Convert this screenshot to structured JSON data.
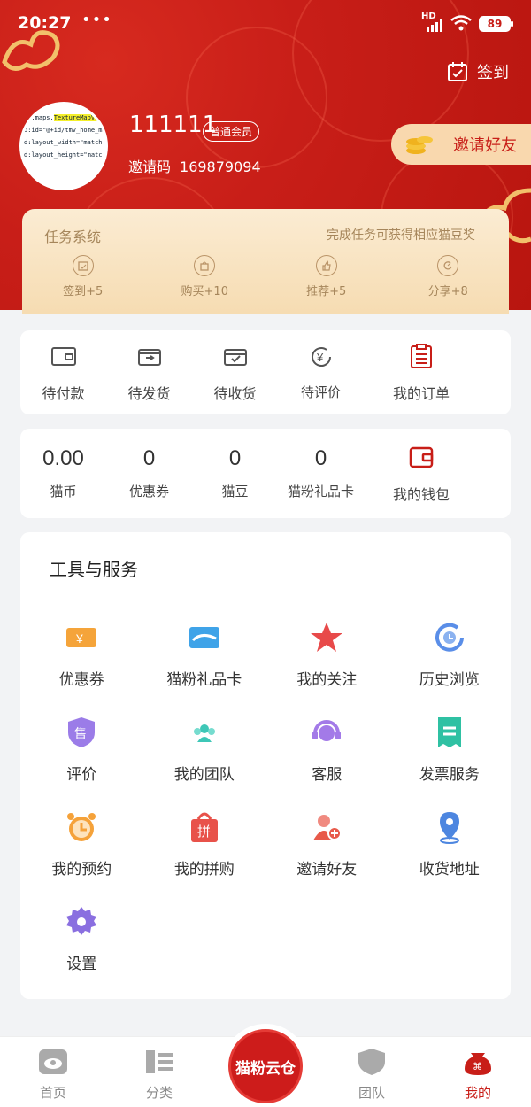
{
  "status": {
    "time": "20:27",
    "dots": "•••",
    "network": "HD",
    "battery": "89"
  },
  "header": {
    "signin_label": "签到"
  },
  "profile": {
    "username": "111111",
    "member_badge": "普通会员",
    "invite_code_label": "邀请码",
    "invite_code": "169879094",
    "invite_button": "邀请好友"
  },
  "task": {
    "title": "任务系统",
    "hint": "完成任务可获得相应猫豆奖",
    "items": [
      {
        "label": "签到+5",
        "icon": "calendar-icon"
      },
      {
        "label": "购买+10",
        "icon": "bag-icon"
      },
      {
        "label": "推荐+5",
        "icon": "thumb-icon"
      },
      {
        "label": "分享+8",
        "icon": "share-icon"
      }
    ]
  },
  "orders": {
    "items": [
      {
        "label": "待付款",
        "icon": "wallet-icon"
      },
      {
        "label": "待发货",
        "icon": "box-icon"
      },
      {
        "label": "待收货",
        "icon": "receive-icon"
      },
      {
        "label": "待评价",
        "icon": "review-icon"
      }
    ],
    "my_orders": "我的订单"
  },
  "wallet": {
    "items": [
      {
        "value": "0.00",
        "label": "猫币"
      },
      {
        "value": "0",
        "label": "优惠券"
      },
      {
        "value": "0",
        "label": "猫豆"
      },
      {
        "value": "0",
        "label": "猫粉礼品卡"
      }
    ],
    "my_wallet": "我的钱包"
  },
  "tools": {
    "title": "工具与服务",
    "items": [
      {
        "label": "优惠券",
        "icon": "coupon-icon",
        "color": "#f5a43a"
      },
      {
        "label": "猫粉礼品卡",
        "icon": "gift-card-icon",
        "color": "#3fa3e8"
      },
      {
        "label": "我的关注",
        "icon": "star-icon",
        "color": "#e84a4a"
      },
      {
        "label": "历史浏览",
        "icon": "history-icon",
        "color": "#5a8ee8"
      },
      {
        "label": "评价",
        "icon": "sale-shield-icon",
        "color": "#9b7ce8"
      },
      {
        "label": "我的团队",
        "icon": "team-icon",
        "color": "#3ec7b7"
      },
      {
        "label": "客服",
        "icon": "headset-icon",
        "color": "#a37ae8"
      },
      {
        "label": "发票服务",
        "icon": "invoice-icon",
        "color": "#2fc1a3"
      },
      {
        "label": "我的预约",
        "icon": "alarm-icon",
        "color": "#f5a23a"
      },
      {
        "label": "我的拼购",
        "icon": "group-buy-icon",
        "color": "#e8524a"
      },
      {
        "label": "邀请好友",
        "icon": "invite-friend-icon",
        "color": "#e85a4a"
      },
      {
        "label": "收货地址",
        "icon": "location-icon",
        "color": "#4d86e0"
      },
      {
        "label": "设置",
        "icon": "gear-icon",
        "color": "#8a6fe0"
      }
    ]
  },
  "nav": {
    "tabs": [
      {
        "label": "首页",
        "icon": "home-icon"
      },
      {
        "label": "分类",
        "icon": "category-icon"
      },
      {
        "label": "",
        "icon": "center"
      },
      {
        "label": "团队",
        "icon": "team-shield-icon"
      },
      {
        "label": "我的",
        "icon": "mine-bag-icon"
      }
    ],
    "center_label": "猫粉云仓"
  },
  "colors": {
    "brand_red": "#c81e18",
    "gold": "#f9d8ae"
  }
}
